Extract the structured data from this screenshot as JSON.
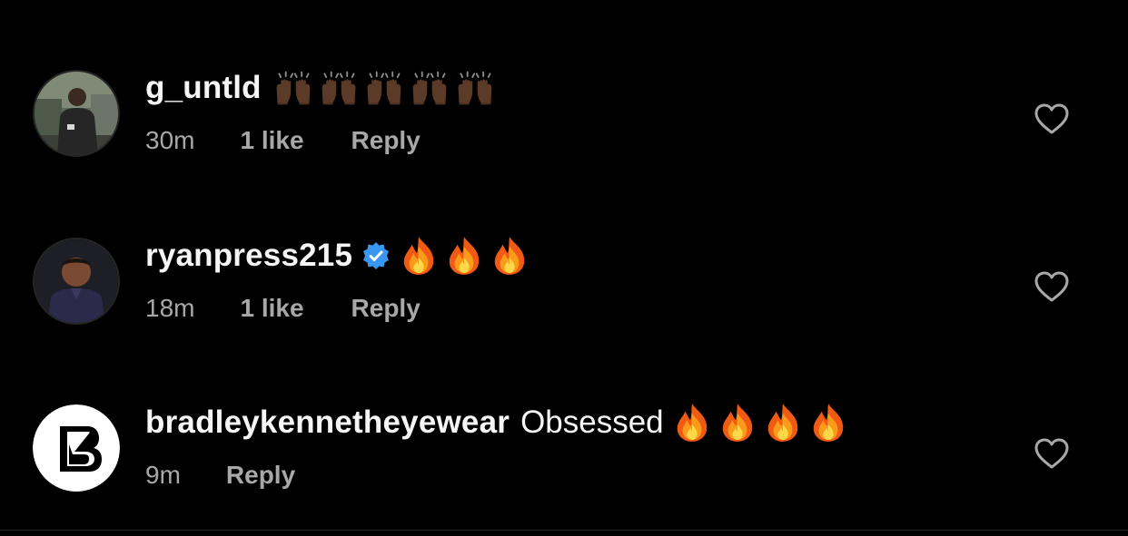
{
  "comments": [
    {
      "username": "g_untld",
      "text": "",
      "emoji": "raising-hands-dark-skin",
      "emoji_count": 5,
      "time": "30m",
      "likes": "1 like",
      "reply": "Reply",
      "verified": false
    },
    {
      "username": "ryanpress215",
      "text": "",
      "emoji": "fire",
      "emoji_count": 3,
      "time": "18m",
      "likes": "1 like",
      "reply": "Reply",
      "verified": true
    },
    {
      "username": "bradleykennetheyewear",
      "text": "Obsessed",
      "emoji": "fire",
      "emoji_count": 4,
      "time": "9m",
      "likes": "",
      "reply": "Reply",
      "verified": false
    }
  ],
  "colors": {
    "background": "#000000",
    "primary_text": "#f5f5f5",
    "secondary_text": "#a8a8a8",
    "verified_badge": "#3897f0",
    "heart_outline": "#a8a8a8"
  },
  "icons": {
    "like": "heart-outline-icon",
    "verified": "verified-badge-icon"
  }
}
